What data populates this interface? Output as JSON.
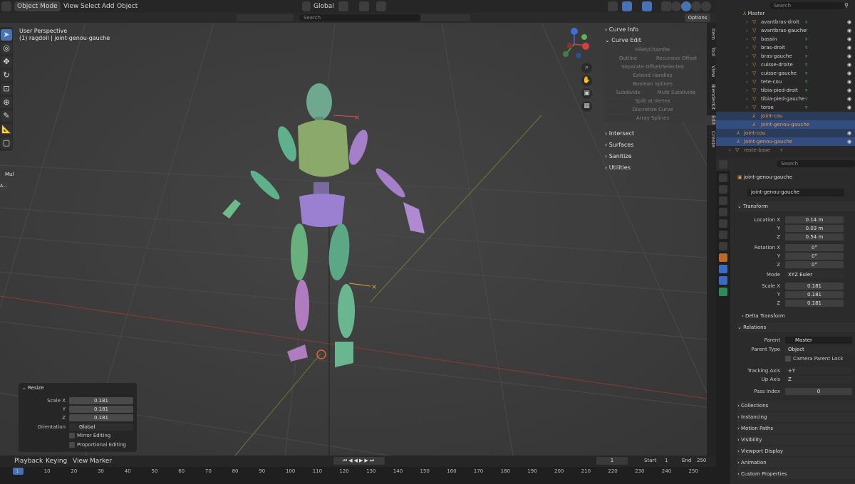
{
  "topbar": {
    "mode": "Object Mode",
    "menus": [
      "View",
      "Select",
      "Add",
      "Object"
    ],
    "transform_orientation": "Global",
    "options_label": "Options",
    "search_placeholder": "Search"
  },
  "viewport": {
    "perspective_label": "User Perspective",
    "object_label": "(1) ragdoll | joint-genou-gauche",
    "mul_label": "Mul",
    "a_label": "A..."
  },
  "npanel": {
    "sections": {
      "curve_info": "Curve Info",
      "curve_edit": "Curve Edit",
      "intersect": "Intersect",
      "surfaces": "Surfaces",
      "sanitize": "Sanitize",
      "utilities": "Utilities"
    },
    "curve_edit_buttons": {
      "fillet": "Fillet/Chamfer",
      "outline": "Outline",
      "recursive_offset": "Recursive Offset",
      "separate": "Separate Offset/Selected",
      "extend": "Extend Handles",
      "boolean": "Boolean Splines",
      "subdivide": "Subdivide",
      "multi_subdivide": "Multi Subdivide",
      "split": "Split at Vertex",
      "discretize": "Discretize Curve",
      "array": "Array Splines"
    }
  },
  "sidetabs": [
    "Item",
    "Tool",
    "View",
    "BlenderKit",
    "Edit",
    "Create"
  ],
  "resize_panel": {
    "title": "Resize",
    "scale_x_label": "Scale X",
    "y_label": "Y",
    "z_label": "Z",
    "scale_x": "0.181",
    "scale_y": "0.181",
    "scale_z": "0.181",
    "orientation_label": "Orientation",
    "orientation": "Global",
    "mirror_editing": "Mirror Editing",
    "proportional_editing": "Proportional Editing"
  },
  "timeline": {
    "menus": [
      "Playback",
      "Keying",
      "View",
      "Marker"
    ],
    "current_frame": "1",
    "start_label": "Start",
    "start": "1",
    "end_label": "End",
    "end": "250",
    "ticks": [
      "1",
      "10",
      "20",
      "30",
      "40",
      "50",
      "60",
      "70",
      "80",
      "90",
      "100",
      "110",
      "120",
      "130",
      "140",
      "150",
      "160",
      "170",
      "180",
      "190",
      "200",
      "210",
      "220",
      "230",
      "240",
      "250"
    ]
  },
  "outliner": {
    "search_placeholder": "Search",
    "master": "Master",
    "items": [
      "avantbras-droit",
      "avantbras-gauche",
      "bassin",
      "bras-droit",
      "bras-gauche",
      "cuisse-droite",
      "cuisse-gauche",
      "tete-cou",
      "tibia-pied-droit",
      "tibia-pied-gauche",
      "torse"
    ],
    "child_joints": [
      "joint-cou",
      "joint-genou-gauche"
    ],
    "root_joints": [
      "joint-cou",
      "joint-genou-gauche"
    ],
    "reste_base": "reste-base"
  },
  "properties": {
    "search_placeholder": "Search",
    "object_name": "joint-genou-gauche",
    "object_field": "joint-genou-gauche",
    "transform": {
      "title": "Transform",
      "location_label": "Location X",
      "loc_x": "0.14 m",
      "loc_y": "0.03 m",
      "loc_z": "0.54 m",
      "rotation_label": "Rotation X",
      "rot_x": "0°",
      "rot_y": "0°",
      "rot_z": "0°",
      "mode_label": "Mode",
      "mode": "XYZ Euler",
      "scale_label": "Scale X",
      "scale_x": "0.181",
      "scale_y": "0.181",
      "scale_z": "0.181",
      "y_label": "Y",
      "z_label": "Z"
    },
    "delta_transform": "Delta Transform",
    "relations": {
      "title": "Relations",
      "parent_label": "Parent",
      "parent": "Master",
      "parent_type_label": "Parent Type",
      "parent_type": "Object",
      "camera_parent_lock": "Camera Parent Lock",
      "tracking_axis_label": "Tracking Axis",
      "tracking_axis": "+Y",
      "up_axis_label": "Up Axis",
      "up_axis": "Z",
      "pass_index_label": "Pass Index",
      "pass_index": "0"
    },
    "collapsed_sections": [
      "Collections",
      "Instancing",
      "Motion Paths",
      "Visibility",
      "Viewport Display",
      "Animation",
      "Custom Properties"
    ]
  }
}
